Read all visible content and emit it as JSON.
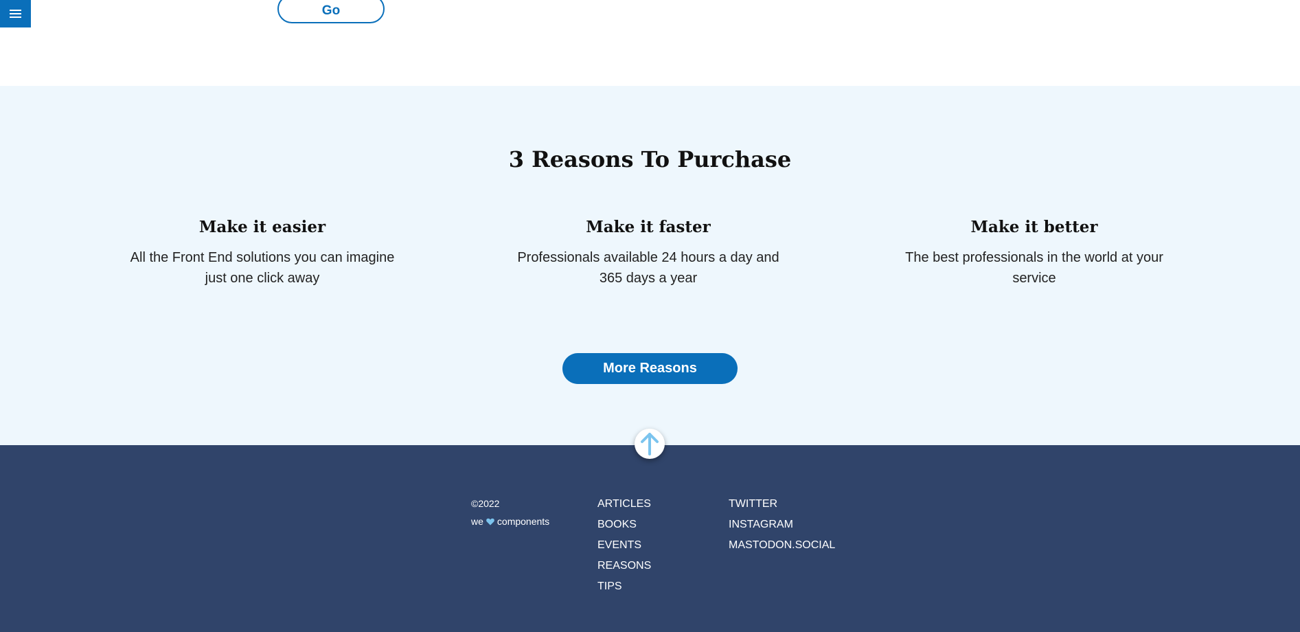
{
  "header": {
    "menu_icon": "hamburger-icon",
    "go_label": "Go"
  },
  "reasons": {
    "title": "3 Reasons To Purchase",
    "items": [
      {
        "title": "Make it easier",
        "text": "All the Front End solutions you can imagine just one click away"
      },
      {
        "title": "Make it faster",
        "text": "Professionals available 24 hours a day and 365 days a year"
      },
      {
        "title": "Make it better",
        "text": "The best professionals in the world at your service"
      }
    ],
    "more_label": "More Reasons"
  },
  "footer": {
    "copyright": "©2022",
    "brand_prefix": "we",
    "brand_suffix": "components",
    "heart_icon": "heart-icon",
    "scroll_top_icon": "arrow-up-icon",
    "nav_links": [
      "ARTICLES",
      "BOOKS",
      "EVENTS",
      "REASONS",
      "TIPS"
    ],
    "social_links": [
      "TWITTER",
      "INSTAGRAM",
      "MASTODON.SOCIAL"
    ]
  },
  "colors": {
    "primary": "#0a6fba",
    "section_bg": "#eef7fd",
    "footer_bg": "#30446a",
    "accent_light": "#7cc4ee"
  }
}
